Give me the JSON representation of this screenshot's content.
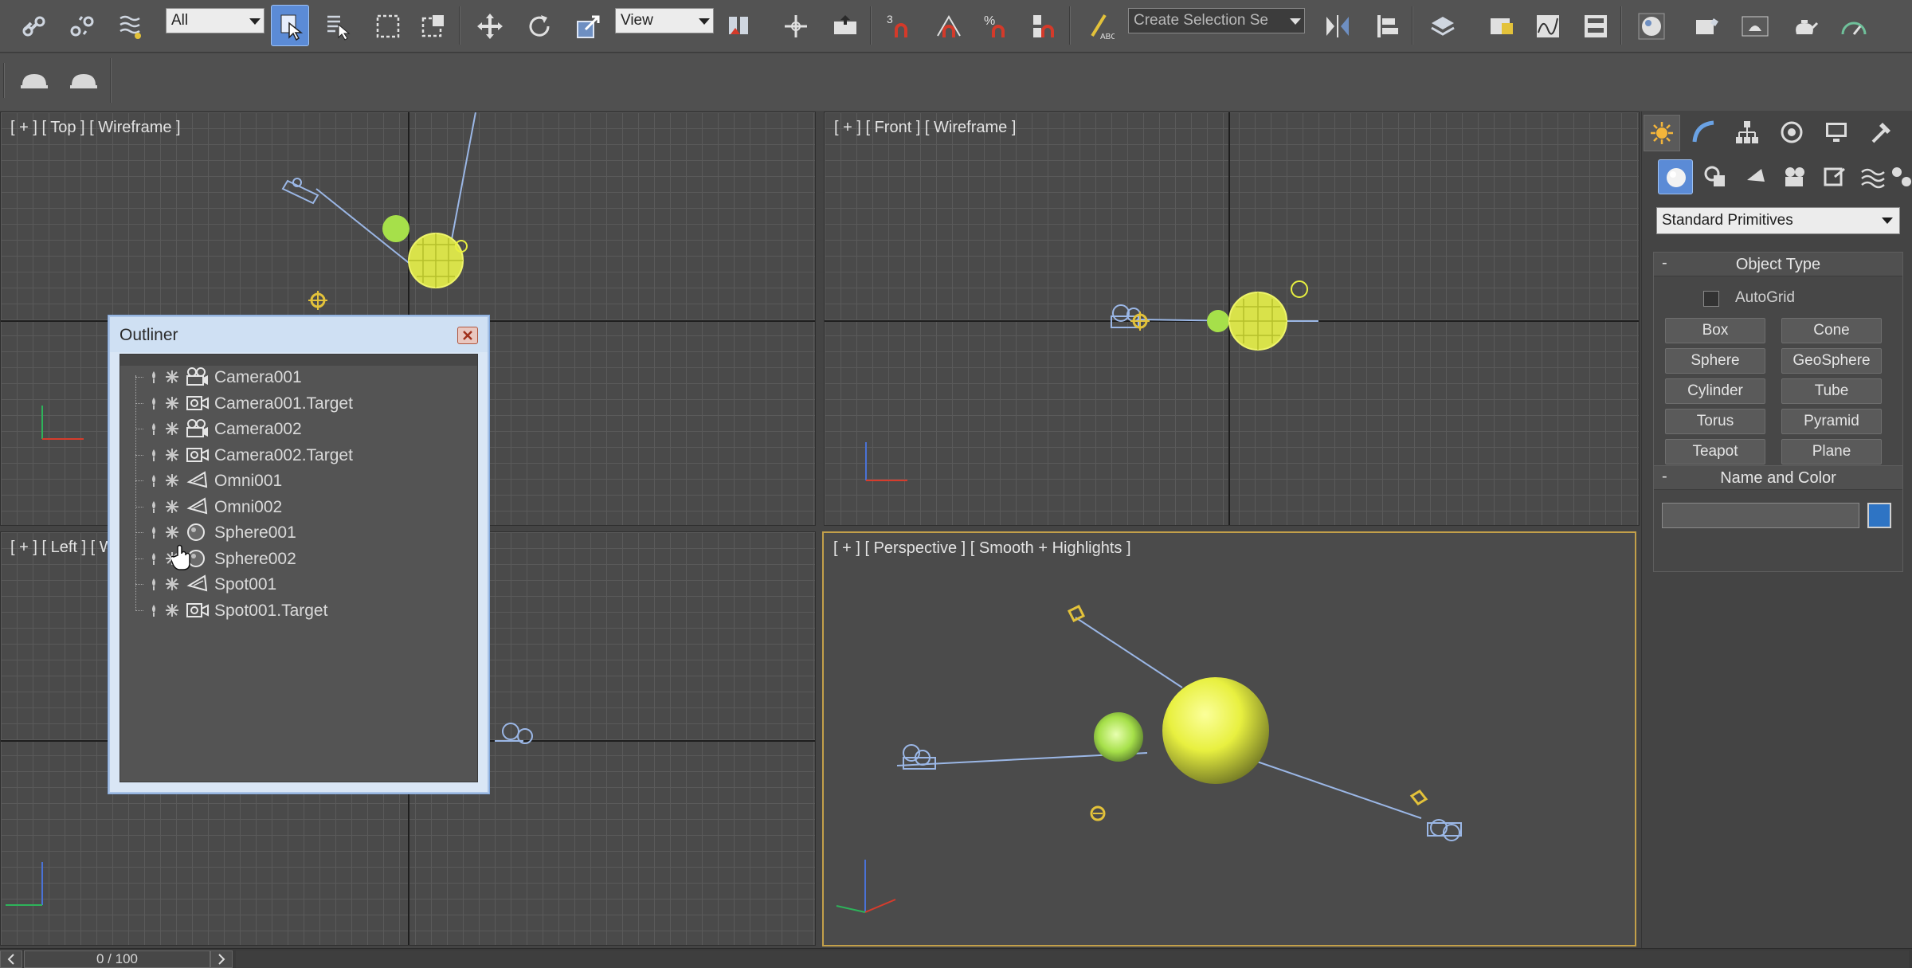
{
  "toolbar": {
    "selection_filter": "All",
    "ref_coord": "View",
    "named_selection": "Create Selection Se"
  },
  "viewports": {
    "top": "[ + ] [ Top ] [ Wireframe ]",
    "front": "[ + ] [ Front ] [ Wireframe ]",
    "left": "[ + ] [ Left ] [ W",
    "perspective": "[ + ] [ Perspective ] [ Smooth + Highlights ]"
  },
  "outliner": {
    "title": "Outliner",
    "items": [
      {
        "name": "Camera001",
        "icon": "camera-icon"
      },
      {
        "name": "Camera001.Target",
        "icon": "target-icon"
      },
      {
        "name": "Camera002",
        "icon": "camera-icon"
      },
      {
        "name": "Camera002.Target",
        "icon": "target-icon"
      },
      {
        "name": "Omni001",
        "icon": "light-icon"
      },
      {
        "name": "Omni002",
        "icon": "light-icon"
      },
      {
        "name": "Sphere001",
        "icon": "sphere-icon"
      },
      {
        "name": "Sphere002",
        "icon": "sphere-icon"
      },
      {
        "name": "Spot001",
        "icon": "light-icon"
      },
      {
        "name": "Spot001.Target",
        "icon": "target-icon"
      }
    ]
  },
  "command_panel": {
    "category_dropdown": "Standard Primitives",
    "object_type": {
      "title": "Object Type",
      "autogrid": "AutoGrid",
      "buttons": [
        "Box",
        "Cone",
        "Sphere",
        "GeoSphere",
        "Cylinder",
        "Tube",
        "Torus",
        "Pyramid",
        "Teapot",
        "Plane"
      ]
    },
    "name_and_color": {
      "title": "Name and Color",
      "name_value": "",
      "swatch_color": "#2e74c4"
    }
  },
  "timeslider": {
    "position": "0 / 100"
  },
  "colors": {
    "selection_yellow": "#e8f040",
    "sphere_green": "#a6e04a",
    "helper_blue": "#9bb7e6",
    "viewport_active_border": "#c3a04a"
  }
}
